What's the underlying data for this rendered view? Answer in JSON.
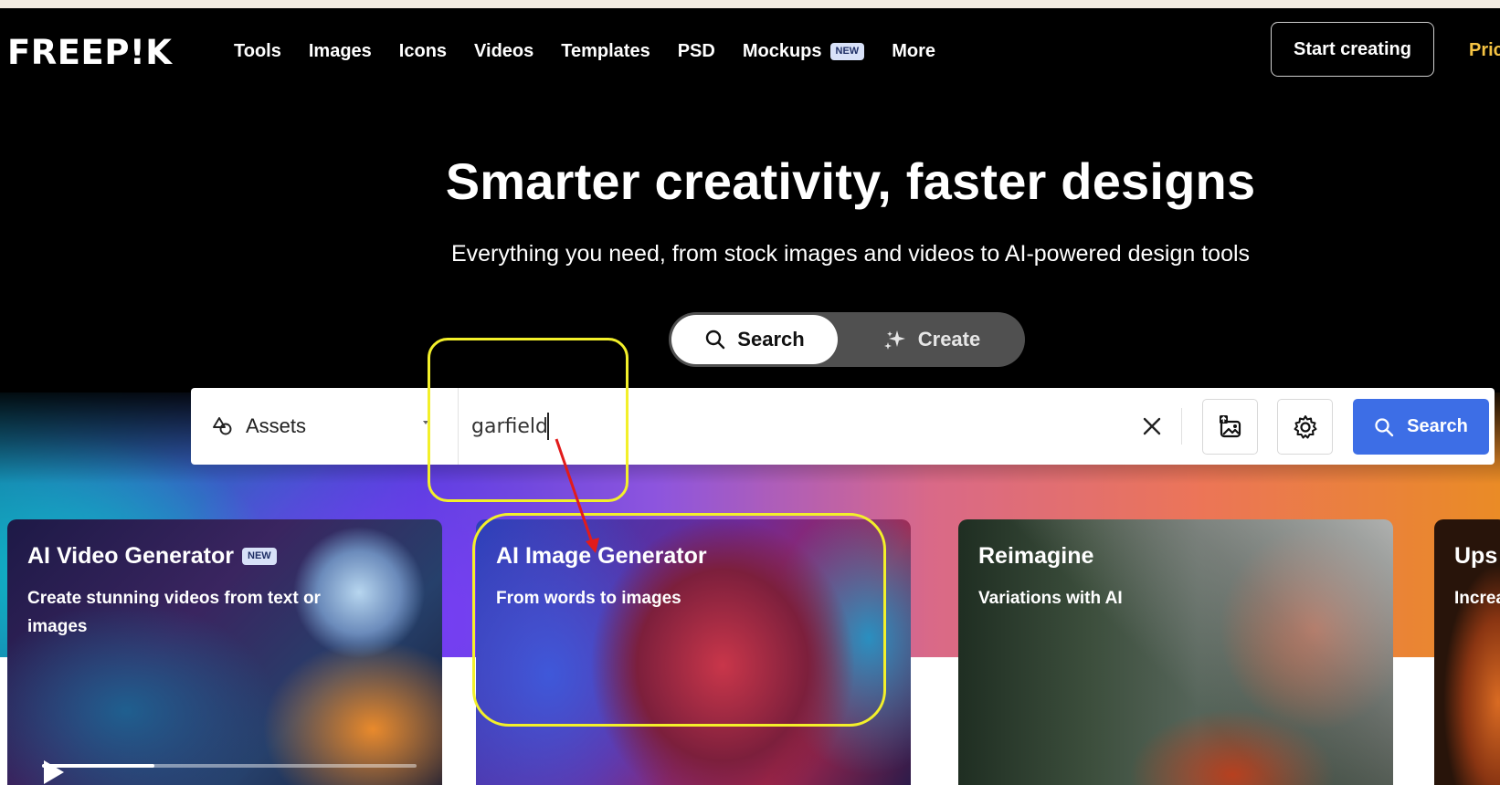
{
  "nav": {
    "logo": "FREEP!K",
    "links": [
      "Tools",
      "Images",
      "Icons",
      "Videos",
      "Templates",
      "PSD",
      "Mockups",
      "More"
    ],
    "mockups_badge": "NEW",
    "start_button": "Start creating",
    "pricing": "Pric"
  },
  "hero": {
    "title": "Smarter creativity, faster designs",
    "subtitle": "Everything you need, from stock images and videos to AI-powered design tools"
  },
  "mode": {
    "search_label": "Search",
    "create_label": "Create"
  },
  "searchbar": {
    "category": "Assets",
    "query": "garfield",
    "search_button": "Search"
  },
  "cards": [
    {
      "title": "AI Video Generator",
      "badge": "NEW",
      "description": "Create stunning videos from text or images"
    },
    {
      "title": "AI Image Generator",
      "description": "From words to images"
    },
    {
      "title": "Reimagine",
      "description": "Variations with AI"
    },
    {
      "title": "Ups",
      "description": "Increa"
    }
  ],
  "video": {
    "progress": 0.3
  },
  "colors": {
    "accent_blue": "#3d6ee6",
    "pricing_yellow": "#f5c343",
    "annotation_yellow": "#f3f02a",
    "annotation_arrow": "#e21b1b"
  }
}
